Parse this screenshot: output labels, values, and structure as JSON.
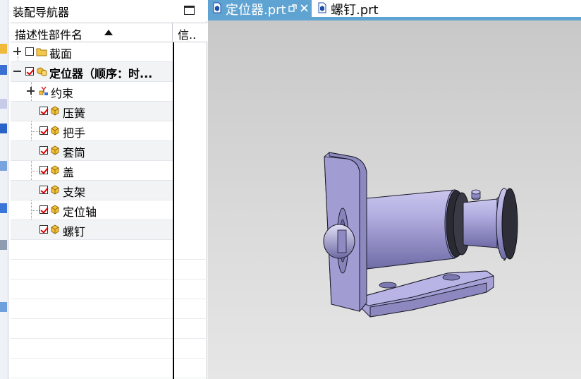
{
  "navigator": {
    "title": "装配导航器",
    "columns": {
      "description": "描述性部件名",
      "info": "信.."
    },
    "tree": {
      "section": "截面",
      "root": "定位器（顺序：时...",
      "constraints": "约束",
      "parts": [
        "压簧",
        "把手",
        "套筒",
        "盖",
        "支架",
        "定位轴",
        "螺钉"
      ]
    }
  },
  "tabs": [
    {
      "label": "定位器.prt",
      "active": true
    },
    {
      "label": "螺钉.prt",
      "active": false
    }
  ],
  "colors": {
    "tab_active": "#5fa3d2",
    "model": "#aaa6dc",
    "check": "#dd0000"
  }
}
